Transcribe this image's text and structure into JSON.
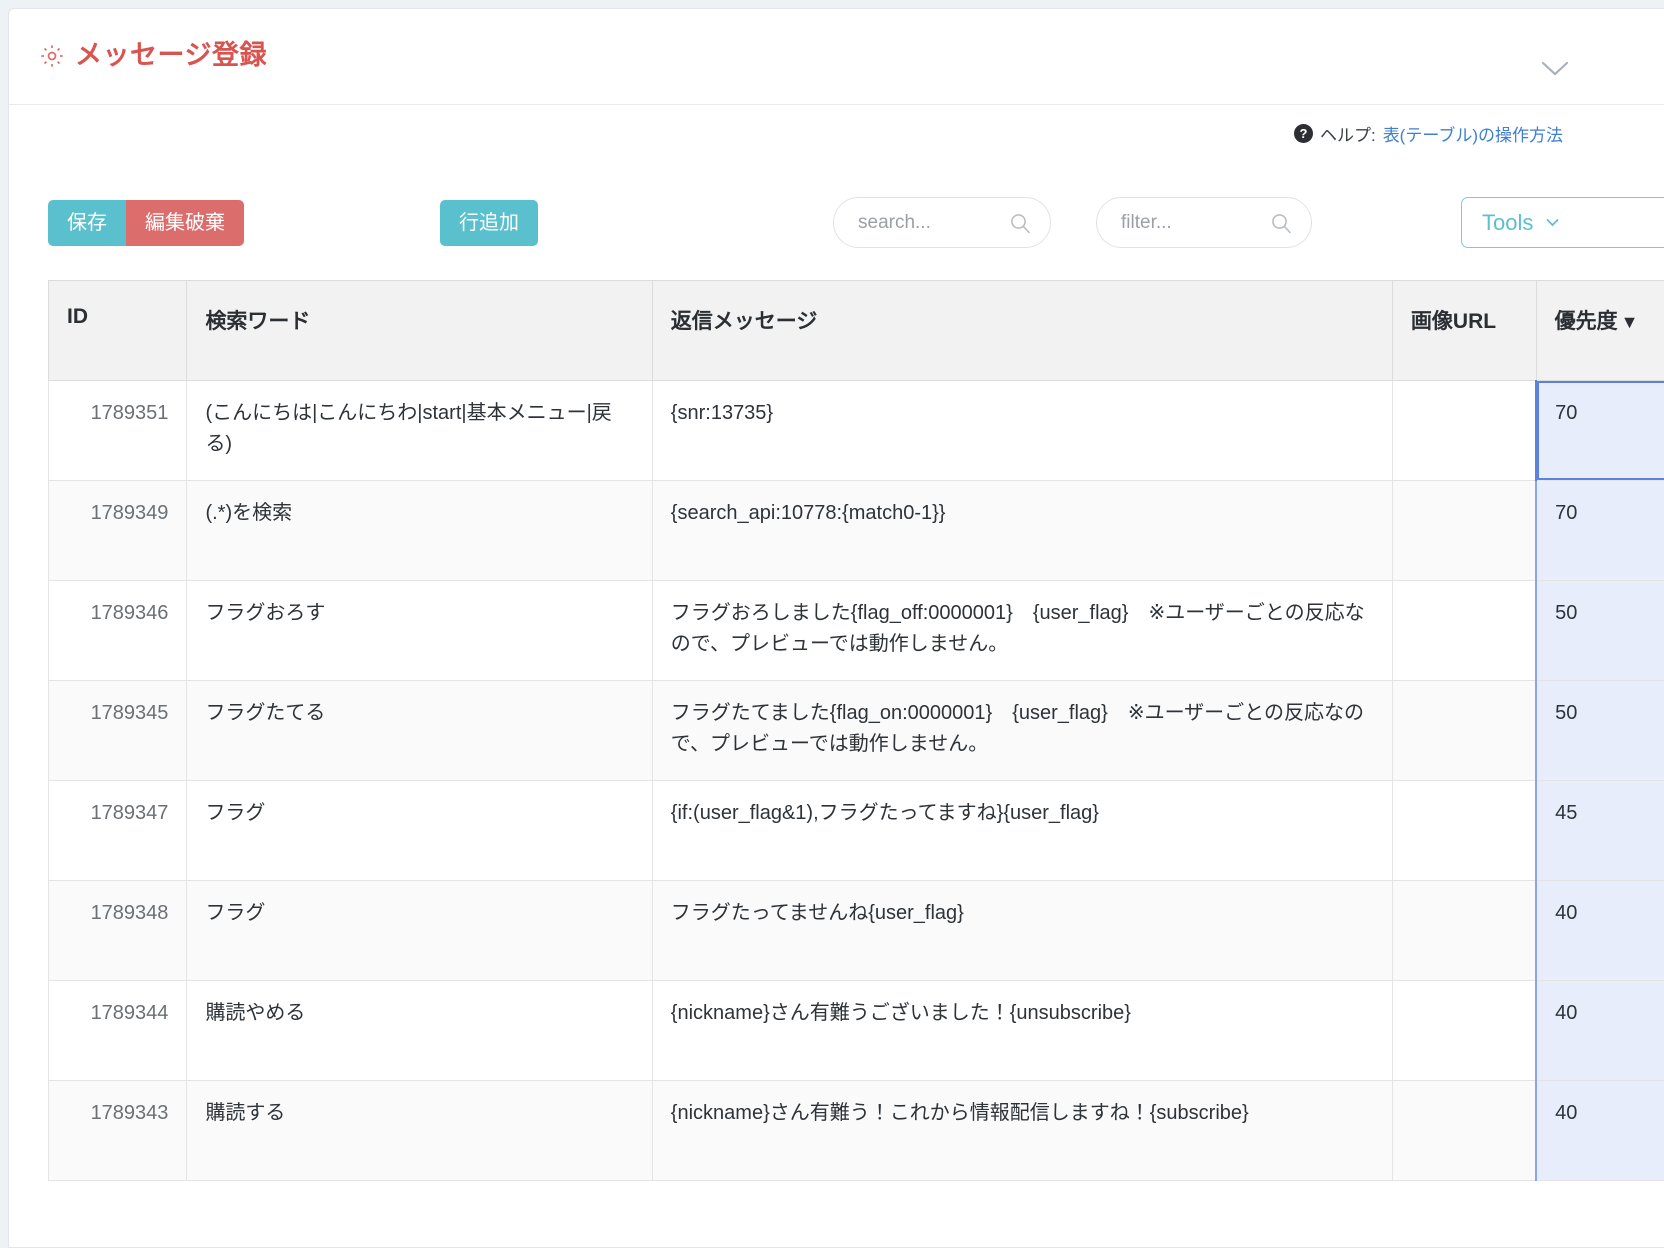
{
  "header": {
    "title": "メッセージ登録",
    "gear_icon": "gear-icon",
    "collapse_icon": "chevron-down-icon",
    "accent_color": "#d9534f"
  },
  "help": {
    "icon": "question-circle-icon",
    "label": "ヘルプ:",
    "link_text": "表(テーブル)の操作方法",
    "link_color": "#3f7fd0"
  },
  "toolbar": {
    "save_label": "保存",
    "discard_label": "編集破棄",
    "add_row_label": "行追加",
    "tools_label": "Tools",
    "tools_chevron": "chevron-down-icon",
    "search": {
      "placeholder": "search...",
      "value": "",
      "icon": "search-icon"
    },
    "filter": {
      "placeholder": "filter...",
      "value": "",
      "icon": "search-icon"
    },
    "teal_color": "#5bc0ce",
    "red_color": "#dc6d6d"
  },
  "table": {
    "columns": [
      {
        "key": "id",
        "label": "ID"
      },
      {
        "key": "word",
        "label": "検索ワード"
      },
      {
        "key": "message",
        "label": "返信メッセージ"
      },
      {
        "key": "image_url",
        "label": "画像URL"
      },
      {
        "key": "priority",
        "label": "優先度",
        "sort": "▼",
        "sort_direction": "desc"
      }
    ],
    "selected_cell": {
      "row": 0,
      "column": "priority"
    },
    "rows": [
      {
        "id": "1789351",
        "word": "(こんにちは|こんにちわ|start|基本メニュー|戻る)",
        "message": "{snr:13735}",
        "image_url": "",
        "priority": "70"
      },
      {
        "id": "1789349",
        "word": "(.*)を検索",
        "message": "{search_api:10778:{match0-1}}",
        "image_url": "",
        "priority": "70"
      },
      {
        "id": "1789346",
        "word": "フラグおろす",
        "message": "フラグおろしました{flag_off:0000001}　{user_flag}　※ユーザーごとの反応なので、プレビューでは動作しません。",
        "image_url": "",
        "priority": "50"
      },
      {
        "id": "1789345",
        "word": "フラグたてる",
        "message": "フラグたてました{flag_on:0000001}　{user_flag}　※ユーザーごとの反応なので、プレビューでは動作しません。",
        "image_url": "",
        "priority": "50"
      },
      {
        "id": "1789347",
        "word": "フラグ",
        "message": "{if:(user_flag&1),フラグたってますね}{user_flag}",
        "image_url": "",
        "priority": "45"
      },
      {
        "id": "1789348",
        "word": "フラグ",
        "message": "フラグたってませんね{user_flag}",
        "image_url": "",
        "priority": "40"
      },
      {
        "id": "1789344",
        "word": "購読やめる",
        "message": "{nickname}さん有難うございました！{unsubscribe}",
        "image_url": "",
        "priority": "40"
      },
      {
        "id": "1789343",
        "word": "購読する",
        "message": "{nickname}さん有難う！これから情報配信しますね！{subscribe}",
        "image_url": "",
        "priority": "40"
      }
    ]
  }
}
